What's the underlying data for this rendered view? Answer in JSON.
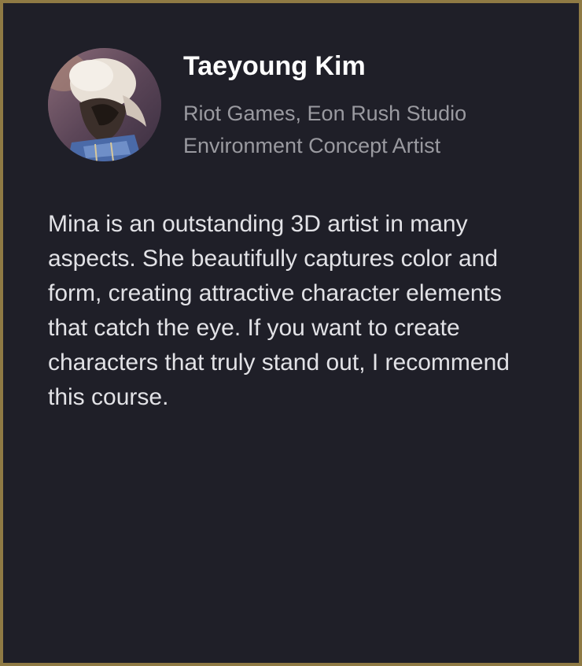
{
  "colors": {
    "background": "#1f1f28",
    "border": "#8f7a44",
    "name": "#ffffff",
    "meta": "#9a9aa0",
    "quote": "#e2e2e6"
  },
  "testimonial": {
    "avatar_icon": "reviewer-avatar",
    "name": "Taeyoung Kim",
    "company": "Riot Games, Eon Rush Studio",
    "role": "Environment Concept Artist",
    "quote": "Mina is an outstanding 3D artist in many aspects. She beautifully captures color and form, creating attractive character elements that catch the eye. If you want to create characters that truly stand out, I recommend this course."
  }
}
